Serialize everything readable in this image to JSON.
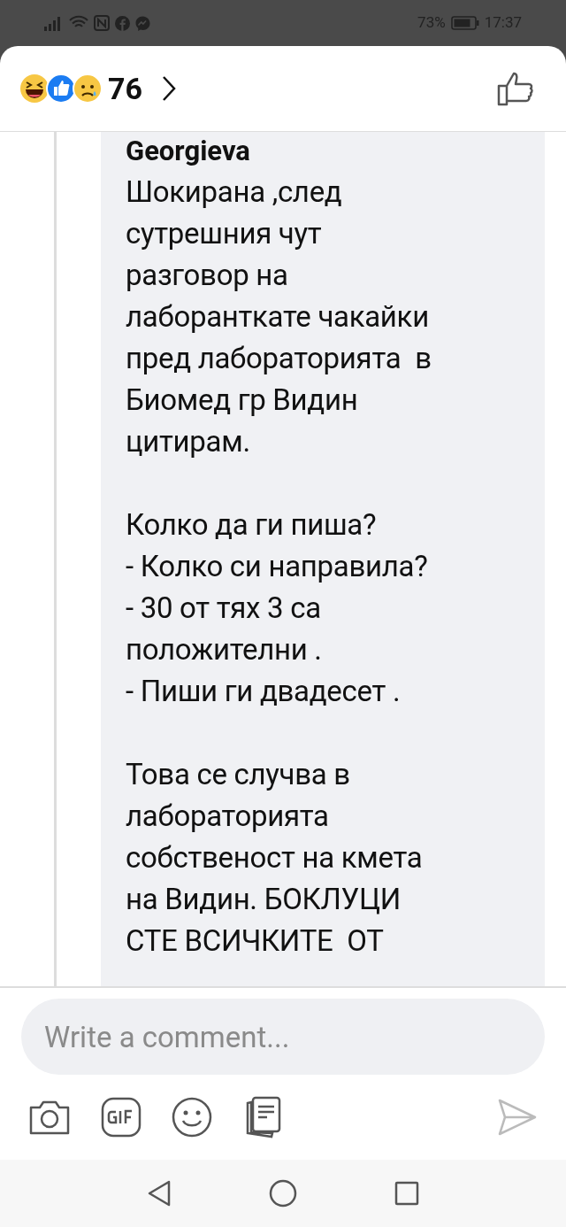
{
  "status_bar": {
    "battery": "73%",
    "time": "17:37"
  },
  "reactions": {
    "count": "76"
  },
  "comment": {
    "author": "Georgieva",
    "paragraphs": [
      "Шокирана ,след\nсутрешния чут\nразговор на\nлаборанткате чакайки\nпред лабораторията  в\nБиомед гр Видин\nцитирам.",
      "Колко да ги пиша?\n- Колко си направила?\n- 30 от тях 3 са\nположителни .\n- Пиши ги двадесет .",
      "Това се случва в\nлабораторията\nсобственост на кмета\nна Видин. БОКЛУЦИ\nСТЕ ВСИЧКИТЕ  ОТ"
    ]
  },
  "composer": {
    "placeholder": "Write a comment..."
  }
}
